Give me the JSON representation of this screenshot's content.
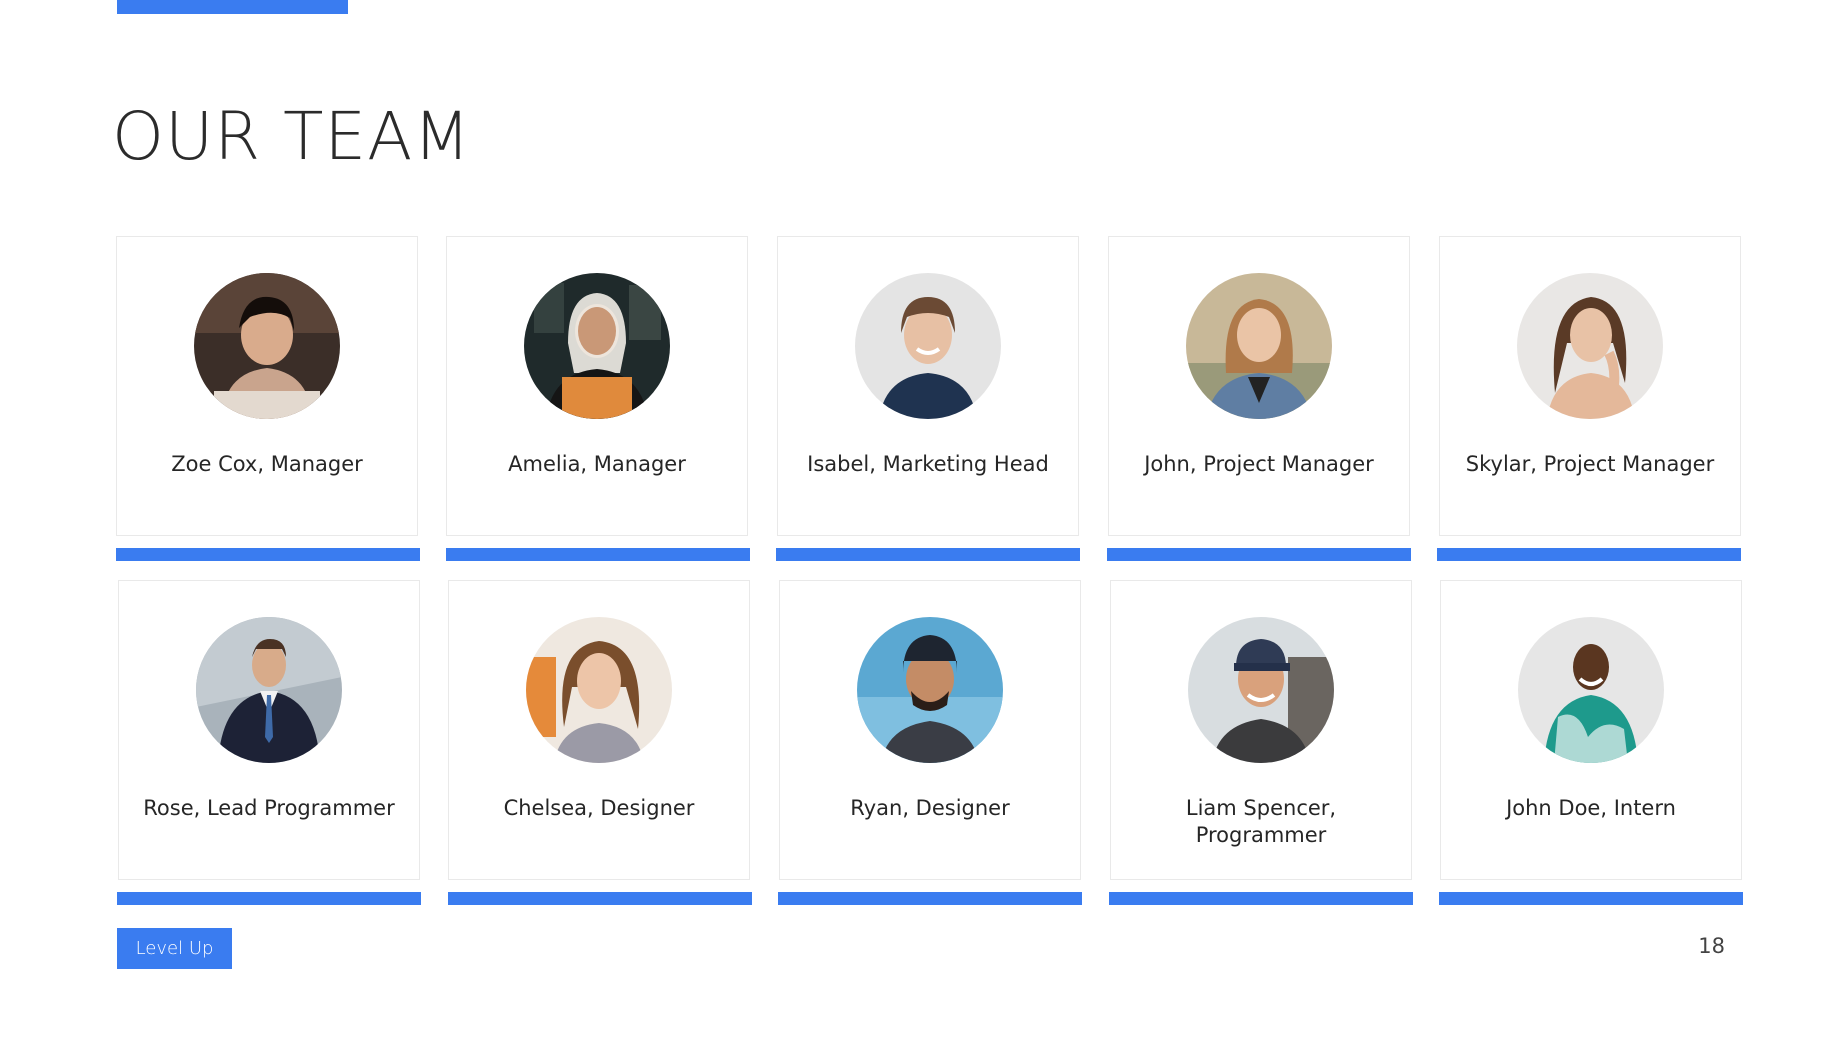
{
  "slide": {
    "title": "OUR TEAM",
    "footer_label": "Level Up",
    "page_number": "18"
  },
  "colors": {
    "accent": "#3a7cf0"
  },
  "team": [
    {
      "name": "Zoe Cox, Manager",
      "photo": "woman-portrait-photo"
    },
    {
      "name": "Amelia, Manager",
      "photo": "woman-portrait-photo"
    },
    {
      "name": "Isabel, Marketing Head",
      "photo": "woman-portrait-photo"
    },
    {
      "name": "John, Project Manager",
      "photo": "woman-portrait-photo"
    },
    {
      "name": "Skylar, Project Manager",
      "photo": "woman-portrait-photo"
    },
    {
      "name": "Rose, Lead Programmer",
      "photo": "man-portrait-photo"
    },
    {
      "name": "Chelsea, Designer",
      "photo": "woman-portrait-photo"
    },
    {
      "name": "Ryan, Designer",
      "photo": "man-portrait-photo"
    },
    {
      "name": "Liam Spencer, Programmer",
      "photo": "man-portrait-photo"
    },
    {
      "name": "John Doe, Intern",
      "photo": "man-portrait-photo"
    }
  ]
}
